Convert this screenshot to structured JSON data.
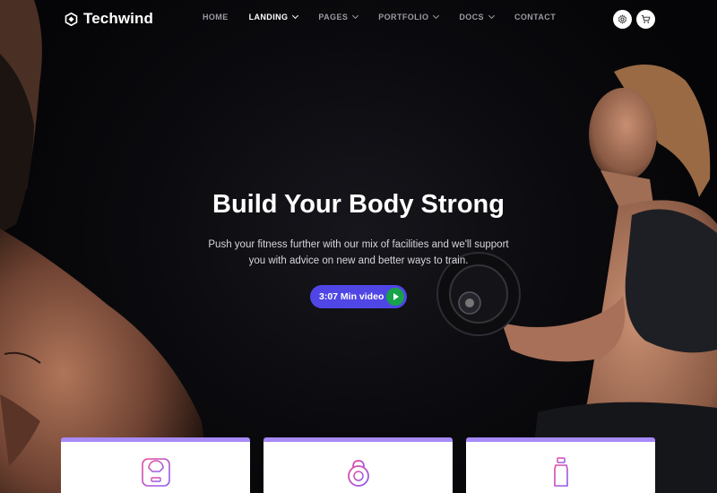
{
  "brand": {
    "name": "Techwind"
  },
  "nav": {
    "items": [
      {
        "label": "HOME",
        "active": false,
        "has_dropdown": false
      },
      {
        "label": "LANDING",
        "active": true,
        "has_dropdown": true
      },
      {
        "label": "PAGES",
        "active": false,
        "has_dropdown": true
      },
      {
        "label": "PORTFOLIO",
        "active": false,
        "has_dropdown": true
      },
      {
        "label": "DOCS",
        "active": false,
        "has_dropdown": true
      },
      {
        "label": "CONTACT",
        "active": false,
        "has_dropdown": false
      }
    ],
    "icons": [
      "gear-icon",
      "cart-icon"
    ]
  },
  "hero": {
    "headline": "Build Your Body Strong",
    "subtext": "Push your fitness further with our mix of facilities and we'll support you with advice on new and better ways to train.",
    "video_button": {
      "label": "3:07 Min video",
      "icon": "play-icon"
    }
  },
  "cards": [
    {
      "icon": "scale-icon"
    },
    {
      "icon": "kettlebell-icon"
    },
    {
      "icon": "water-bottle-icon"
    }
  ],
  "colors": {
    "background": "#070709",
    "accent": "#4f46e5",
    "play": "#16a34a",
    "card_border": "#a78bfa",
    "icon_stroke": "#a855f7"
  }
}
